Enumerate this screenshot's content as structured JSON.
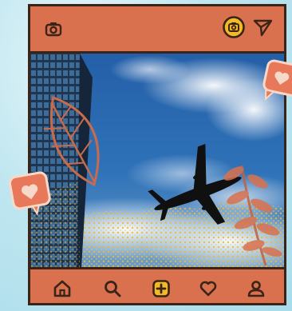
{
  "app": {
    "top_bar": {
      "left_icon": "camera-icon",
      "right_icons": [
        "camera-sticker-icon",
        "send-icon"
      ]
    },
    "post": {
      "image_semantics": "airplane-sky-clouds-building",
      "overlays": [
        "leaf-outline-icon",
        "heart-speech-bubble-icon",
        "fern-branch-icon"
      ]
    },
    "bottom_nav": {
      "items": [
        "home-icon",
        "search-icon",
        "add-post-icon",
        "heart-icon",
        "profile-icon"
      ]
    },
    "colors": {
      "frame": "#d9714e",
      "outline": "#3a2418",
      "accent_yellow": "#f2b928",
      "sky": "#2f6fb4",
      "heart_bubble": "#e2725b",
      "background": "#bfe6f0"
    }
  }
}
